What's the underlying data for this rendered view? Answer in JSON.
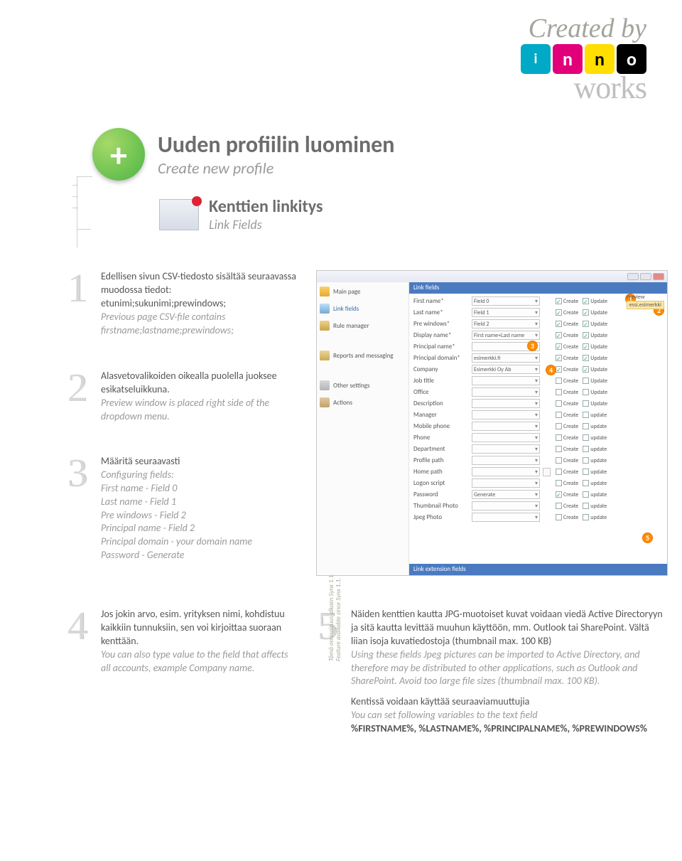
{
  "logo": {
    "created_by": "Created by",
    "letters": [
      "i",
      "n",
      "n",
      "o"
    ],
    "works": "works"
  },
  "header": {
    "title_fi": "Uuden profiilin luominen",
    "title_en": "Create new profile",
    "sub_fi": "Kenttien linkitys",
    "sub_en": "Link Fields"
  },
  "steps": {
    "s1": {
      "num": "1",
      "fi": "Edellisen sivun CSV-tiedosto sisältää seuraavassa muodossa tiedot: etunimi;sukunimi;prewindows;",
      "en": "Previous page CSV-file contains firstname;lastname;prewindows;"
    },
    "s2": {
      "num": "2",
      "fi": "Alasvetovalikoiden oikealla puolella juoksee esikatseluikkuna.",
      "en": "Preview window is placed right side of the dropdown menu."
    },
    "s3": {
      "num": "3",
      "fi_intro": "Määritä seuraavasti",
      "en_intro": "Configuring fields:",
      "lines": [
        "First name - Field 0",
        "Last name - Field 1",
        "Pre windows - Field 2",
        "Principal name - Field 2",
        "Principal domain - your domain name",
        "Password - Generate"
      ]
    },
    "s4": {
      "num": "4",
      "fi": "Jos jokin arvo, esim. yrityksen nimi, kohdistuu kaikkiin tunnuksiin, sen voi kirjoittaa suoraan kenttään.",
      "en": "You can also type value to the field that affects all accounts, example Company name."
    },
    "s5": {
      "num": "5",
      "fi1": "Näiden kenttien kautta JPG-muotoiset kuvat voidaan viedä Active Directoryyn ja sitä kautta levittää muuhun käyttöön, mm. Outlook tai SharePoint. Vältä liian isoja kuvatiedostoja (thumbnail max. 100 KB)",
      "en1": "Using these fields Jpeg pictures can be imported to Active Directory, and therefore may be distributed to other applications, such as Outlook and SharePoint. Avoid too large file sizes (thumbnail max. 100 KB).",
      "fi2": "Kentissä voidaan käyttää seuraaviamuuttujia",
      "en2": "You can set following variables to the text field",
      "vars": "%FIRSTNAME%, %LASTNAME%, %PRINCIPALNAME%, %PREWINDOWS%"
    }
  },
  "rot": {
    "fi": "Tämä ominaisuus alkaen Synx 1.1",
    "en": "Feature available since Synx 1.1."
  },
  "app": {
    "sidebar": [
      "Main page",
      "Link fields",
      "Rule manager",
      "Reports and messaging",
      "Other settings",
      "Actions"
    ],
    "bar_top": "Link fields",
    "bar_bot": "Link extension fields",
    "rows": [
      {
        "label": "First name*",
        "val": "Field 0",
        "create": true,
        "update": true
      },
      {
        "label": "Last name*",
        "val": "Field 1",
        "create": true,
        "update": true
      },
      {
        "label": "Pre windows*",
        "val": "Field 2",
        "create": true,
        "update": true
      },
      {
        "label": "Display name*",
        "val": "First name+Last name",
        "create": true,
        "update": true
      },
      {
        "label": "Principal name*",
        "val": "",
        "create": true,
        "update": true
      },
      {
        "label": "Principal domain*",
        "val": "esimerkki.fi",
        "create": true,
        "update": true
      },
      {
        "label": "Company",
        "val": "Esimerkki Oy Ab",
        "create": true,
        "update": true
      },
      {
        "label": "Job title",
        "val": "",
        "create": false,
        "update": false
      },
      {
        "label": "Office",
        "val": "",
        "create": false,
        "update": false
      },
      {
        "label": "Description",
        "val": "",
        "create": false,
        "update": false
      },
      {
        "label": "Manager",
        "val": "",
        "create": false,
        "update": false
      },
      {
        "label": "Mobile phone",
        "val": "",
        "create": false,
        "update": false
      },
      {
        "label": "Phone",
        "val": "",
        "create": false,
        "update": false
      },
      {
        "label": "Department",
        "val": "",
        "create": false,
        "update": false
      },
      {
        "label": "Profile path",
        "val": "",
        "create": false,
        "update": false
      },
      {
        "label": "Home path",
        "val": "",
        "dd": true,
        "create": false,
        "update": false
      },
      {
        "label": "Logon script",
        "val": "",
        "create": false,
        "update": false
      },
      {
        "label": "Password",
        "val": "Generate",
        "create": true,
        "update": false
      },
      {
        "label": "Thumbnail Photo",
        "val": "",
        "create": false,
        "update": false
      },
      {
        "label": "Jpeg Photo",
        "val": "",
        "create": false,
        "update": false
      }
    ],
    "cb_labels": {
      "create": "Create",
      "update": "Update"
    },
    "preview_label": "Preview",
    "preview_val": "essi.esimerkki",
    "callouts": [
      "1",
      "2",
      "3",
      "4",
      "5"
    ]
  }
}
